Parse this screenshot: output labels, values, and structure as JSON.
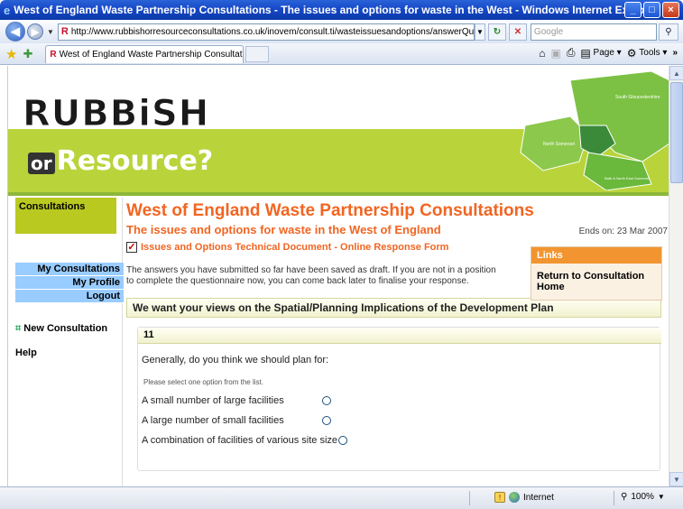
{
  "window": {
    "title": "West of England Waste Partnership Consultations - The issues and options for waste in the West  - Windows Internet Explorer",
    "buttons": [
      "minimize-button",
      "maximize-button",
      "close-button"
    ]
  },
  "address_bar": {
    "url": "http://www.rubbishorresourceconsultations.co.uk/inovem/consult.ti/wasteissuesandoptions/answerQuestionnaire?qi",
    "search_placeholder": "Google"
  },
  "tabs": [
    {
      "label": "West of England Waste Partnership Consultations - T..."
    }
  ],
  "command_bar": {
    "page_label": "Page",
    "tools_label": "Tools",
    "more": "»"
  },
  "banner": {
    "logo_line1": "RUBBiSH",
    "logo_or": "or",
    "logo_line2": "Resource?",
    "map_labels": [
      "South Gloucestershire",
      "North Somerset",
      "Bath & North East Somerset"
    ]
  },
  "sidebar": {
    "heading": "Consultations",
    "items": [
      {
        "label": "My Consultations"
      },
      {
        "label": "My Profile"
      },
      {
        "label": "Logout"
      }
    ],
    "new_consultation": "New Consultation",
    "help": "Help"
  },
  "main": {
    "title": "West of England Waste Partnership Consultations",
    "subtitle": "The issues and options for waste in the West of England",
    "ends_on": "Ends on: 23 Mar 2007",
    "document_link": "Issues and Options Technical Document - Online Response Form",
    "draft_message": "The answers you have submitted so far have been saved as draft. If you are not in a position to complete the questionnaire now, you can come back later to finalise your response.",
    "links": {
      "heading": "Links",
      "items": [
        "Return to Consultation Home"
      ]
    },
    "section_title": "We want your views on the Spatial/Planning Implications of the Development Plan",
    "question": {
      "number": "11",
      "text": "Generally, do you think we should plan for:",
      "hint": "Please select one option from the list.",
      "options": [
        "A small number of large facilities",
        "A large number of small facilities",
        "A combination of facilities of various site size"
      ]
    }
  },
  "status_bar": {
    "zone": "Internet",
    "zoom": "100%"
  },
  "colors": {
    "accent_orange": "#f26522",
    "banner_green": "#b9d43b",
    "nav_blue": "#99ccff",
    "consultations_olive": "#b9c920"
  }
}
